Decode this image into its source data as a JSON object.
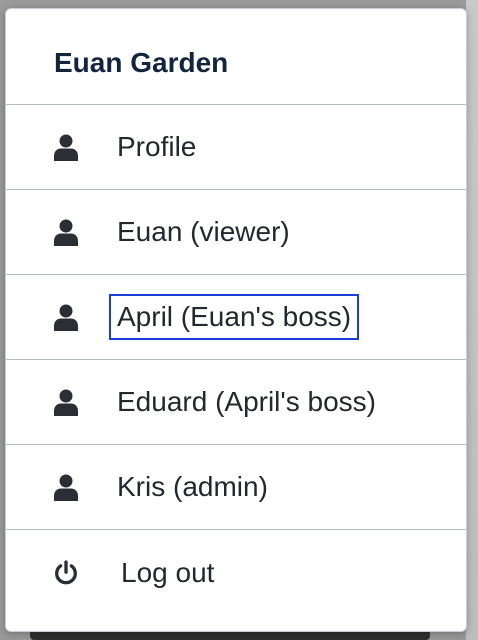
{
  "menu": {
    "title": "Euan Garden",
    "items": [
      {
        "label": "Profile",
        "icon": "user-icon"
      },
      {
        "label": "Euan (viewer)",
        "icon": "user-icon"
      },
      {
        "label": "April (Euan's boss)",
        "icon": "user-icon",
        "focused": true
      },
      {
        "label": "Eduard (April's boss)",
        "icon": "user-icon"
      },
      {
        "label": "Kris (admin)",
        "icon": "user-icon"
      },
      {
        "label": "Log out",
        "icon": "power-icon"
      }
    ]
  },
  "colors": {
    "title": "#13243d",
    "text": "#24282e",
    "divider": "#b5bcc4",
    "focus_outline": "#1b3fd6"
  }
}
